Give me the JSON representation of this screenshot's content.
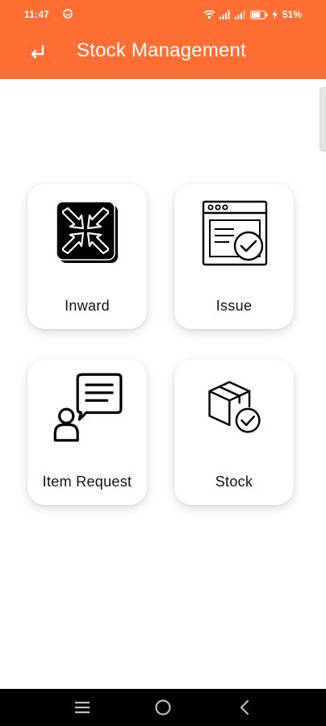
{
  "status_bar": {
    "time": "11:47",
    "battery_percent": "51%",
    "icons": [
      "notification-icon",
      "wifi-icon",
      "signal-icon",
      "signal-icon",
      "battery-icon",
      "charging-icon"
    ]
  },
  "app_bar": {
    "title": "Stock Management",
    "back_icon": "back-arrow-icon",
    "background_color": "#FF6F33"
  },
  "menu": {
    "items": [
      {
        "label": "Inward",
        "icon": "inward-icon"
      },
      {
        "label": "Issue",
        "icon": "issue-icon"
      },
      {
        "label": "Item Request",
        "icon": "item-request-icon"
      },
      {
        "label": "Stock",
        "icon": "stock-icon"
      }
    ]
  },
  "nav_bar": {
    "buttons": [
      "menu-icon",
      "home-icon",
      "back-icon"
    ]
  }
}
